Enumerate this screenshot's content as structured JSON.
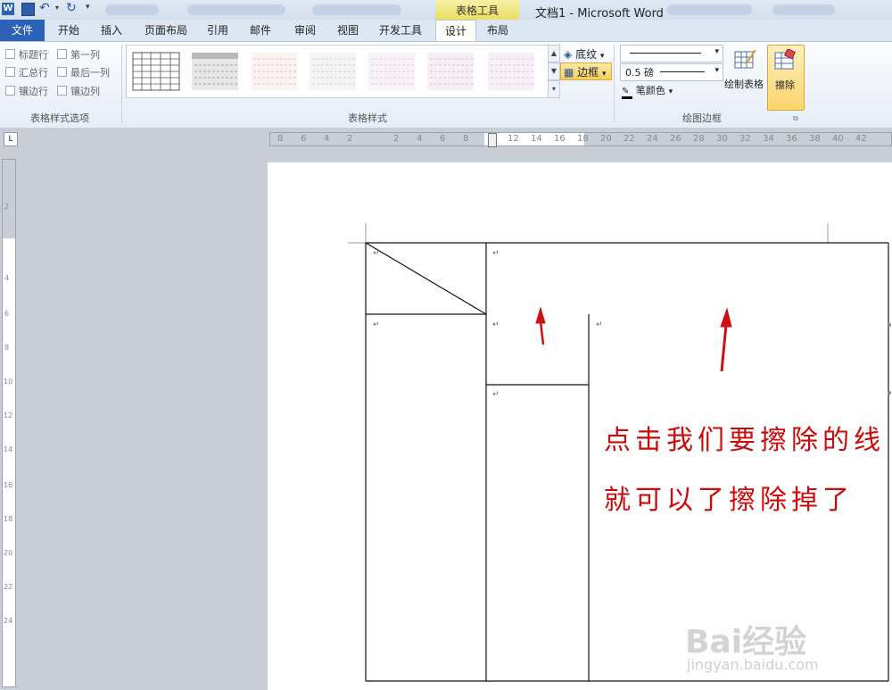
{
  "window": {
    "title": "文档1 - Microsoft Word",
    "context_tab_group": "表格工具"
  },
  "quick_access": [
    "save-icon",
    "undo-icon",
    "redo-icon",
    "customize-icon"
  ],
  "tabs": [
    {
      "label": "文件",
      "active": false
    },
    {
      "label": "开始",
      "active": false
    },
    {
      "label": "插入",
      "active": false
    },
    {
      "label": "页面布局",
      "active": false
    },
    {
      "label": "引用",
      "active": false
    },
    {
      "label": "邮件",
      "active": false
    },
    {
      "label": "审阅",
      "active": false
    },
    {
      "label": "视图",
      "active": false
    },
    {
      "label": "开发工具",
      "active": false
    },
    {
      "label": "设计",
      "active": true
    },
    {
      "label": "布局",
      "active": false
    }
  ],
  "ribbon": {
    "options_group": {
      "label": "表格样式选项",
      "checkboxes": [
        "标题行",
        "第一列",
        "汇总行",
        "最后一列",
        "镶边行",
        "镶边列"
      ]
    },
    "styles_group": {
      "label": "表格样式",
      "shading": "底纹",
      "borders": "边框"
    },
    "draw_group": {
      "label": "绘图边框",
      "line_weight": "0.5 磅",
      "pen_color": "笔颜色",
      "draw_table": "绘制表格",
      "eraser": "擦除"
    }
  },
  "ruler": {
    "horizontal_ticks": [
      "8",
      "6",
      "4",
      "2",
      "2",
      "4",
      "6",
      "8",
      "12",
      "14",
      "16",
      "18",
      "20",
      "22",
      "24",
      "26",
      "28",
      "30",
      "32",
      "34",
      "36",
      "38",
      "40",
      "42"
    ],
    "vertical_ticks": [
      "2",
      "4",
      "6",
      "8",
      "10",
      "12",
      "14",
      "16",
      "18",
      "20",
      "22",
      "24"
    ]
  },
  "annotation": {
    "line1": "点击我们要擦除的线",
    "line2": "就可以了擦除掉了",
    "color": "#cc0a0a"
  },
  "watermark": {
    "brand": "Bai经验",
    "url": "jingyan.baidu.com"
  }
}
